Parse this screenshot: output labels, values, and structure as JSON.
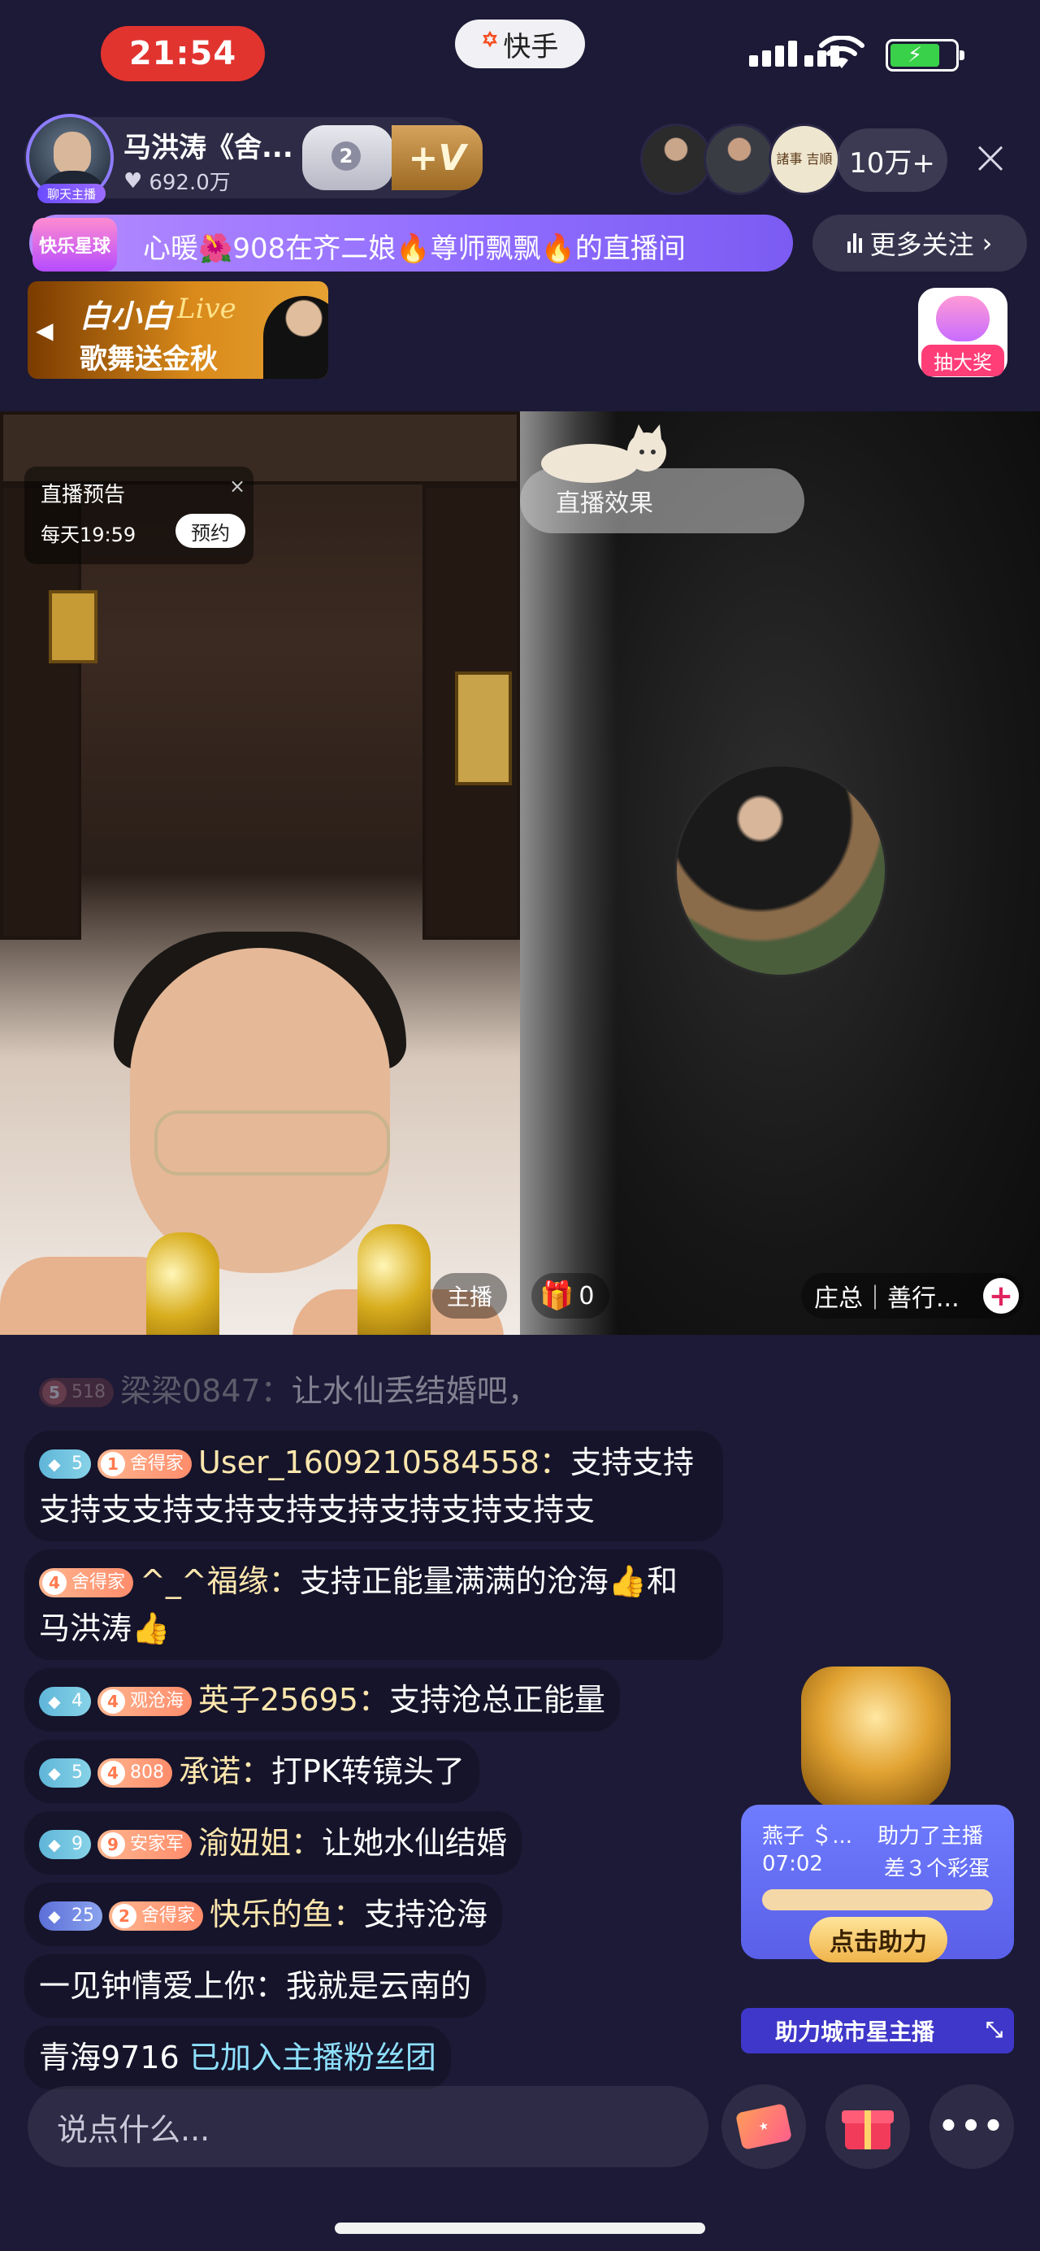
{
  "status_bar": {
    "time": "21:54",
    "app_name": "快手",
    "app_logo": "kuaishou-logo"
  },
  "streamer": {
    "name": "马洪涛《舍...",
    "likes": "692.0万",
    "badge": "聊天主播",
    "level": "2",
    "vip_label": "+V"
  },
  "viewers": {
    "count": "10万+",
    "v3_text": "諸事 吉順"
  },
  "marquee": {
    "badge": "快乐星球",
    "text": "心暖🌺908在齐二娘🔥尊师飘飘🔥的直播间"
  },
  "follow_more": "更多关注",
  "banner": {
    "title": "白小白",
    "live": "Live",
    "subtitle": "歌舞送金秋"
  },
  "lottery": "抽大奖",
  "left_pane": {
    "preview_title": "直播预告",
    "preview_time": "每天19:59",
    "preview_button": "预约",
    "host_tag": "主播"
  },
  "right_pane": {
    "effect_label": "直播效果",
    "gift_count": "0",
    "guest_name": "庄总｜善行..."
  },
  "chat": [
    {
      "gem": "5",
      "gem_style": "dim",
      "fan": "518",
      "user": "梁梁0847：",
      "text": "让水仙丢结婚吧，",
      "faded": true
    },
    {
      "gem": "5",
      "fan_level": "1",
      "fan": "舍得家",
      "user": "User_1609210584558：",
      "text": "支持支持支持支支持支持支持支持支持支持支持支"
    },
    {
      "fan_level": "4",
      "fan": "舍得家",
      "user": "^_^福缘：",
      "text": "支持正能量满满的沧海👍和马洪涛👍"
    },
    {
      "gem": "4",
      "fan_level": "4",
      "fan": "观沧海",
      "user": "英子25695：",
      "text": "支持沧总正能量"
    },
    {
      "gem": "5",
      "fan_level": "4",
      "fan": "808",
      "user": "承诺：",
      "text": "打PK转镜头了"
    },
    {
      "gem": "9",
      "fan_level": "9",
      "fan": "安家军",
      "user": "渝妞姐：",
      "text": "让她水仙结婚"
    },
    {
      "gem": "25",
      "fan_level": "2",
      "fan": "舍得家",
      "user": "快乐的鱼：",
      "text": "支持沧海"
    },
    {
      "user": "一见钟情爱上你：",
      "text": "我就是云南的"
    },
    {
      "user": "青海9716",
      "system": "已加入主播粉丝团"
    }
  ],
  "city_widget": {
    "user": "燕子 ＄...",
    "action": "助力了主播",
    "timer": "07:02",
    "remaining": "差３个彩蛋",
    "button": "点击助力",
    "footer": "助力城市星主播",
    "progress": 0.0
  },
  "input": {
    "placeholder": "说点什么..."
  },
  "bottom_buttons": [
    "ticket-icon",
    "gift-icon",
    "more-icon"
  ],
  "colors": {
    "accent": "#e2342f",
    "background": "#1c1a36",
    "username": "#fde6ad",
    "system": "#8ee1ff"
  }
}
